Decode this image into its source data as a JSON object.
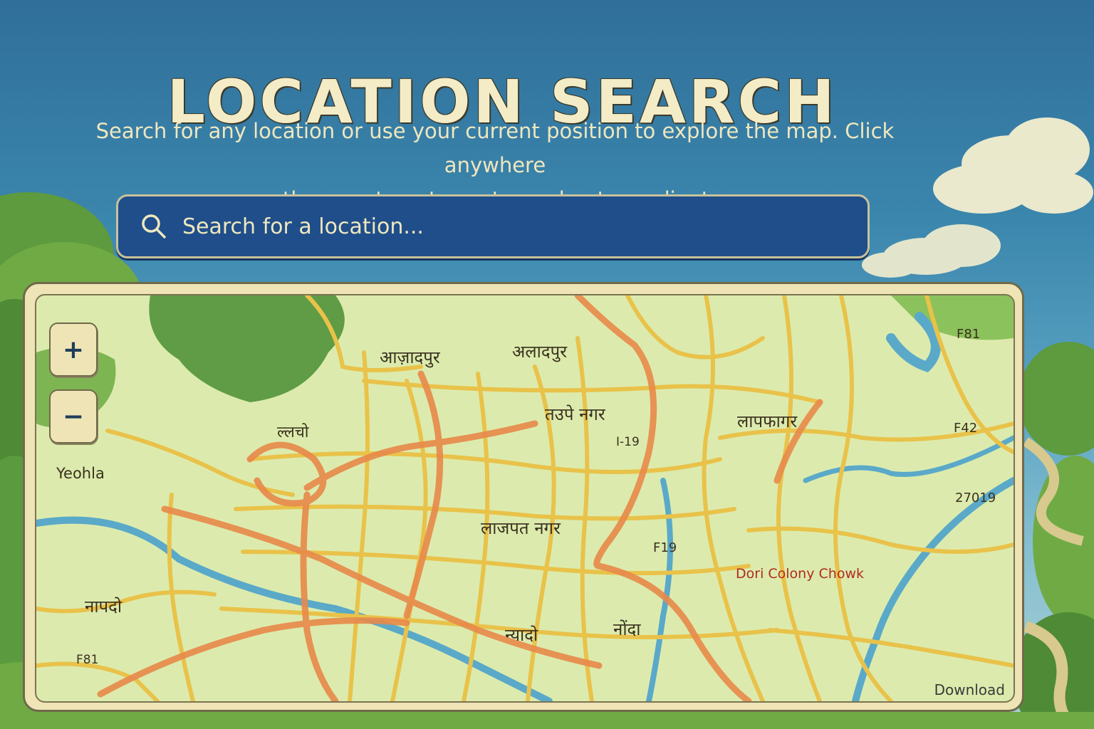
{
  "header": {
    "title": "LOCATION SEARCH",
    "subtitle_line1": "Search for any location or use your current position to explore the map. Click anywhere",
    "subtitle_line2": "on the map to get exact coordmate cordinates."
  },
  "search": {
    "placeholder": "Search for a location...",
    "icon": "search-icon"
  },
  "map": {
    "zoom_in_label": "+",
    "zoom_out_label": "−",
    "download_label": "Download",
    "labels": {
      "azadpur": "आज़ादपुर",
      "alaadpur": "अलादपुर",
      "tajpet_nagar": "तउपे नगर",
      "code_i19": "I-19",
      "lapfagar": "लापफागर",
      "f81_top": "F81",
      "f42": "F42",
      "n27019": "27019",
      "lalcho": "ल्लचो",
      "yeohla": "Yeohla",
      "lajpat_nagar": "लाजपत नगर",
      "f19": "F19",
      "dori_colony_chowk": "Dori Colony Chowk",
      "naapdo": "नापदो",
      "nyaado": "न्यादो",
      "nonda": "नोंदा",
      "f81_bottom": "F81"
    },
    "colors": {
      "major_road": "#e8894a",
      "minor_road": "#e9c24a",
      "river": "#5aa9c9",
      "land": "#dcebad",
      "highlight_label": "#b02a22"
    }
  }
}
